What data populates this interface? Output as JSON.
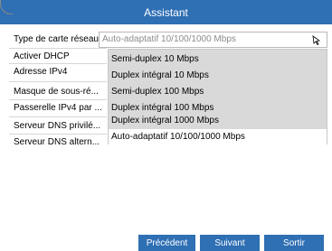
{
  "window": {
    "title": "Assistant"
  },
  "form": {
    "labels": [
      "Type de carte réseau",
      "Activer DHCP",
      "Adresse IPv4",
      "Masque de sous-ré...",
      "Passerelle IPv4 par ...",
      "Serveur DNS privilé...",
      "Serveur DNS altern..."
    ]
  },
  "nic_select": {
    "value": "Auto-adaptatif 10/100/1000 Mbps",
    "options": [
      "Semi-duplex 10 Mbps",
      "Duplex intégral 10 Mbps",
      "Semi-duplex 100 Mbps",
      "Duplex intégral 100 Mbps",
      "Duplex intégral 1000 Mbps",
      "Auto-adaptatif 10/100/1000 Mbps"
    ]
  },
  "buttons": {
    "prev": "Précédent",
    "next": "Suivant",
    "exit": "Sortir"
  },
  "colors": {
    "accent": "#2f6fb3",
    "dropdown_bg": "#d9d9d9",
    "selected_bg": "#ffffff"
  }
}
